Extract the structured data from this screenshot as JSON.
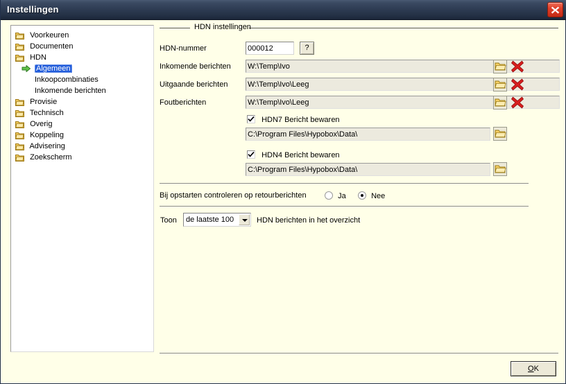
{
  "window": {
    "title": "Instellingen",
    "close_icon": "close-icon"
  },
  "sidebar": {
    "items": [
      {
        "label": "Voorkeuren",
        "icon": "folder-icon",
        "level": 0,
        "selected": false
      },
      {
        "label": "Documenten",
        "icon": "folder-icon",
        "level": 0,
        "selected": false
      },
      {
        "label": "HDN",
        "icon": "folder-icon",
        "level": 0,
        "selected": false
      },
      {
        "label": "Algemeen",
        "icon": "green-arrow-icon",
        "level": 1,
        "selected": true
      },
      {
        "label": "Inkoopcombinaties",
        "icon": "",
        "level": 1,
        "selected": false
      },
      {
        "label": "Inkomende berichten",
        "icon": "",
        "level": 1,
        "selected": false
      },
      {
        "label": "Provisie",
        "icon": "folder-icon",
        "level": 0,
        "selected": false
      },
      {
        "label": "Technisch",
        "icon": "folder-icon",
        "level": 0,
        "selected": false
      },
      {
        "label": "Overig",
        "icon": "folder-icon",
        "level": 0,
        "selected": false
      },
      {
        "label": "Koppeling",
        "icon": "folder-icon",
        "level": 0,
        "selected": false
      },
      {
        "label": "Advisering",
        "icon": "folder-icon",
        "level": 0,
        "selected": false
      },
      {
        "label": "Zoekscherm",
        "icon": "folder-icon",
        "level": 0,
        "selected": false
      }
    ]
  },
  "main": {
    "group_title": "HDN instellingen",
    "fields": {
      "hdn_number": {
        "label": "HDN-nummer",
        "value": "000012",
        "help_button": "?"
      },
      "incoming": {
        "label": "Inkomende berichten",
        "value": "W:\\Temp\\Ivo"
      },
      "outgoing": {
        "label": "Uitgaande berichten",
        "value": "W:\\Temp\\Ivo\\Leeg"
      },
      "errors": {
        "label": "Foutberichten",
        "value": "W:\\Temp\\Ivo\\Leeg"
      }
    },
    "hdn7": {
      "checkbox_label": "HDN7 Bericht bewaren",
      "checked": true,
      "path": "C:\\Program Files\\Hypobox\\Data\\"
    },
    "hdn4": {
      "checkbox_label": "HDN4 Bericht bewaren",
      "checked": true,
      "path": "C:\\Program Files\\Hypobox\\Data\\"
    },
    "startup_check": {
      "label": "Bij opstarten controleren op retourberichten",
      "options": [
        {
          "label": "Ja",
          "selected": false
        },
        {
          "label": "Nee",
          "selected": true
        }
      ]
    },
    "show_row": {
      "prefix_label": "Toon",
      "selected_option": "de laatste 100",
      "suffix_label": "HDN berichten in het overzicht"
    },
    "icons": {
      "browse": "folder-icon",
      "clear": "red-x-icon"
    }
  },
  "footer": {
    "ok_accel": "O",
    "ok_rest": "K"
  },
  "colors": {
    "titlebar": "#2d3b52",
    "dialog_bg": "#ffffe8",
    "selection": "#245edb",
    "close_red": "#e0402a",
    "folder_yellow": "#f5c842",
    "arrow_green": "#4db33d"
  }
}
